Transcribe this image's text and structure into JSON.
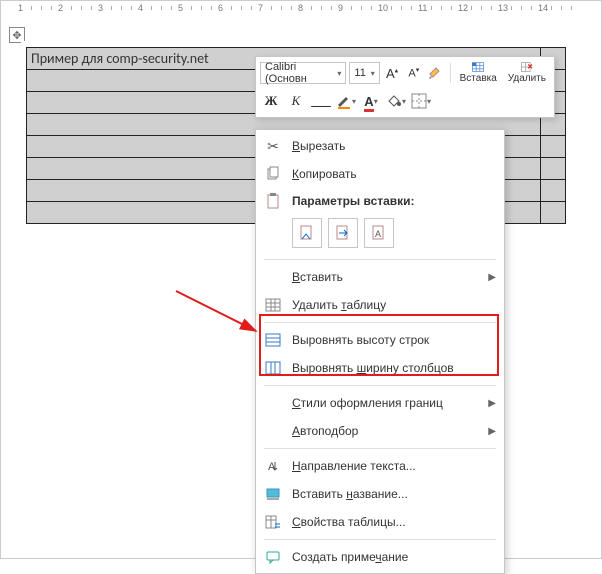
{
  "ruler": {
    "marks": [
      1,
      2,
      3,
      4,
      5,
      6,
      7,
      8,
      9,
      10,
      11,
      12,
      13,
      14
    ]
  },
  "table": {
    "cell_text": "Пример для comp-security.net"
  },
  "mini_toolbar": {
    "font_name": "Calibri (Основн",
    "font_size": "11",
    "insert_label": "Вставка",
    "delete_label": "Удалить"
  },
  "ctx": {
    "cut": "Вырезать",
    "copy": "Копировать",
    "paste_heading": "Параметры вставки:",
    "insert": "Вставить",
    "delete_table": "Удалить таблицу",
    "distribute_rows": "Выровнять высоту строк",
    "distribute_cols": "Выровнять ширину столбцов",
    "border_styles": "Стили оформления границ",
    "autofit": "Автоподбор",
    "text_direction": "Направление текста...",
    "insert_caption": "Вставить название...",
    "table_props": "Свойства таблицы...",
    "new_comment": "Создать примечание"
  }
}
